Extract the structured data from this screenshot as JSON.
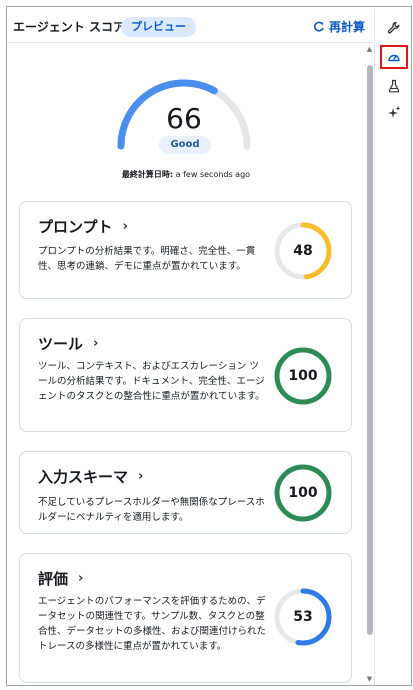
{
  "header": {
    "title": "エージェント スコア",
    "badge": "プレビュー",
    "recalc_label": "再計算"
  },
  "summary": {
    "score": 66,
    "score_text": "66",
    "rating": "Good",
    "calc_label": "最終計算日時:",
    "calc_value": " a few seconds ago",
    "colors": {
      "arc_fill": "#4a8ef0",
      "arc_track": "#e5e6e8"
    }
  },
  "cards": [
    {
      "title": "プロンプト",
      "chevron": "›",
      "desc": "プロンプトの分析結果です。明確さ、完全性、一貫性、思考の連鎖、デモに重点が置かれています。",
      "score": 48,
      "score_text": "48",
      "color": "#f8bd2c"
    },
    {
      "title": "ツール",
      "chevron": "›",
      "desc": "ツール、コンテキスト、およびエスカレーション ツールの分析結果です。ドキュメント、完全性、エージェントのタスクとの整合性に重点が置かれています。",
      "score": 100,
      "score_text": "100",
      "color": "#2e8b57"
    },
    {
      "title": "入力スキーマ",
      "chevron": "›",
      "desc": "不足しているプレースホルダーや無関係なプレースホルダーにペナルティを適用します。",
      "score": 100,
      "score_text": "100",
      "color": "#2e8b57"
    },
    {
      "title": "評価",
      "chevron": "›",
      "desc": "エージェントのパフォーマンスを評価するための、データセットの関連性です。サンプル数、タスクとの整合性、データセットの多様性、および関連付けられたトレースの多様性に重点が置かれています。",
      "score": 53,
      "score_text": "53",
      "color": "#2f7be6"
    }
  ],
  "rail": [
    {
      "icon": "wrench-icon",
      "active": false
    },
    {
      "icon": "gauge-icon",
      "active": true
    },
    {
      "icon": "flask-icon",
      "active": false
    },
    {
      "icon": "sparkle-icon",
      "active": false
    }
  ]
}
